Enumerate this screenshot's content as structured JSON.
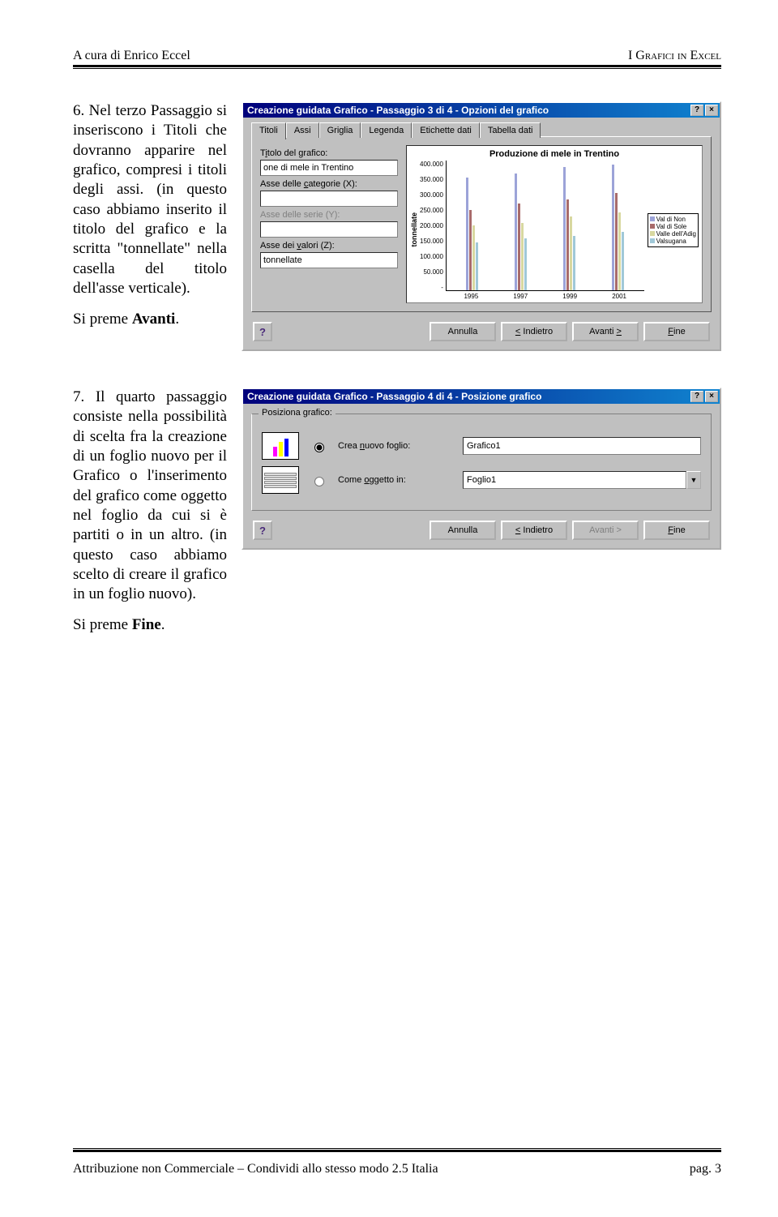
{
  "header": {
    "left": "A cura di Enrico Eccel",
    "right": "I Grafici in Excel"
  },
  "footer": {
    "left": "Attribuzione non Commerciale – Condividi  allo stesso modo 2.5 Italia",
    "right": "pag. 3"
  },
  "para6": {
    "num": "6.",
    "text1": "Nel terzo Passaggio si inseriscono i Titoli che dovranno apparire nel grafico, compresi i titoli degli assi. (in questo caso abbiamo inserito il titolo del grafico e la scritta \"tonnellate\" nella casella del titolo dell'asse verticale).",
    "text2": "Si preme Avanti."
  },
  "para7": {
    "num": "7.",
    "text1": "Il quarto passaggio consiste nella possibilità di scelta fra la creazione di un foglio nuovo per il Grafico o l'inserimento del grafico come oggetto nel foglio da cui si è partiti o in un altro. (in questo caso abbiamo scelto di creare il grafico in un foglio nuovo).",
    "text2": "Si preme Fine."
  },
  "dlg1": {
    "title": "Creazione guidata Grafico - Passaggio 3 di 4 - Opzioni del grafico",
    "tabs": [
      "Titoli",
      "Assi",
      "Griglia",
      "Legenda",
      "Etichette dati",
      "Tabella dati"
    ],
    "lblTitolo": "Titolo del grafico:",
    "valTitolo": "one di mele in Trentino",
    "lblCatX": "Asse delle categorie (X):",
    "lblSerY": "Asse delle serie (Y):",
    "lblValZ": "Asse dei valori (Z):",
    "valZ": "tonnellate",
    "btnAnnulla": "Annulla",
    "btnIndietro": "< Indietro",
    "btnAvanti": "Avanti >",
    "btnFine": "Fine"
  },
  "chart_data": {
    "type": "bar",
    "title": "Produzione di mele in Trentino",
    "ylabel": "tonnellate",
    "categories": [
      "1995",
      "1997",
      "1999",
      "2001"
    ],
    "yticks": [
      50000,
      100000,
      150000,
      200000,
      250000,
      300000,
      350000,
      400000
    ],
    "ylim": [
      0,
      400000
    ],
    "series": [
      {
        "name": "Val di Non",
        "values": [
          350000,
          360000,
          380000,
          390000
        ]
      },
      {
        "name": "Val di Sole",
        "values": [
          250000,
          270000,
          280000,
          300000
        ]
      },
      {
        "name": "Valle dell'Adig",
        "values": [
          200000,
          210000,
          230000,
          240000
        ]
      },
      {
        "name": "Valsugana",
        "values": [
          150000,
          160000,
          170000,
          180000
        ]
      }
    ]
  },
  "dlg2": {
    "title": "Creazione guidata Grafico - Passaggio 4 di 4 - Posizione grafico",
    "grp": "Posiziona grafico:",
    "opt1": "Crea nuovo foglio:",
    "val1": "Grafico1",
    "opt2": "Come oggetto in:",
    "val2": "Foglio1",
    "btnAnnulla": "Annulla",
    "btnIndietro": "< Indietro",
    "btnAvanti": "Avanti >",
    "btnFine": "Fine"
  }
}
